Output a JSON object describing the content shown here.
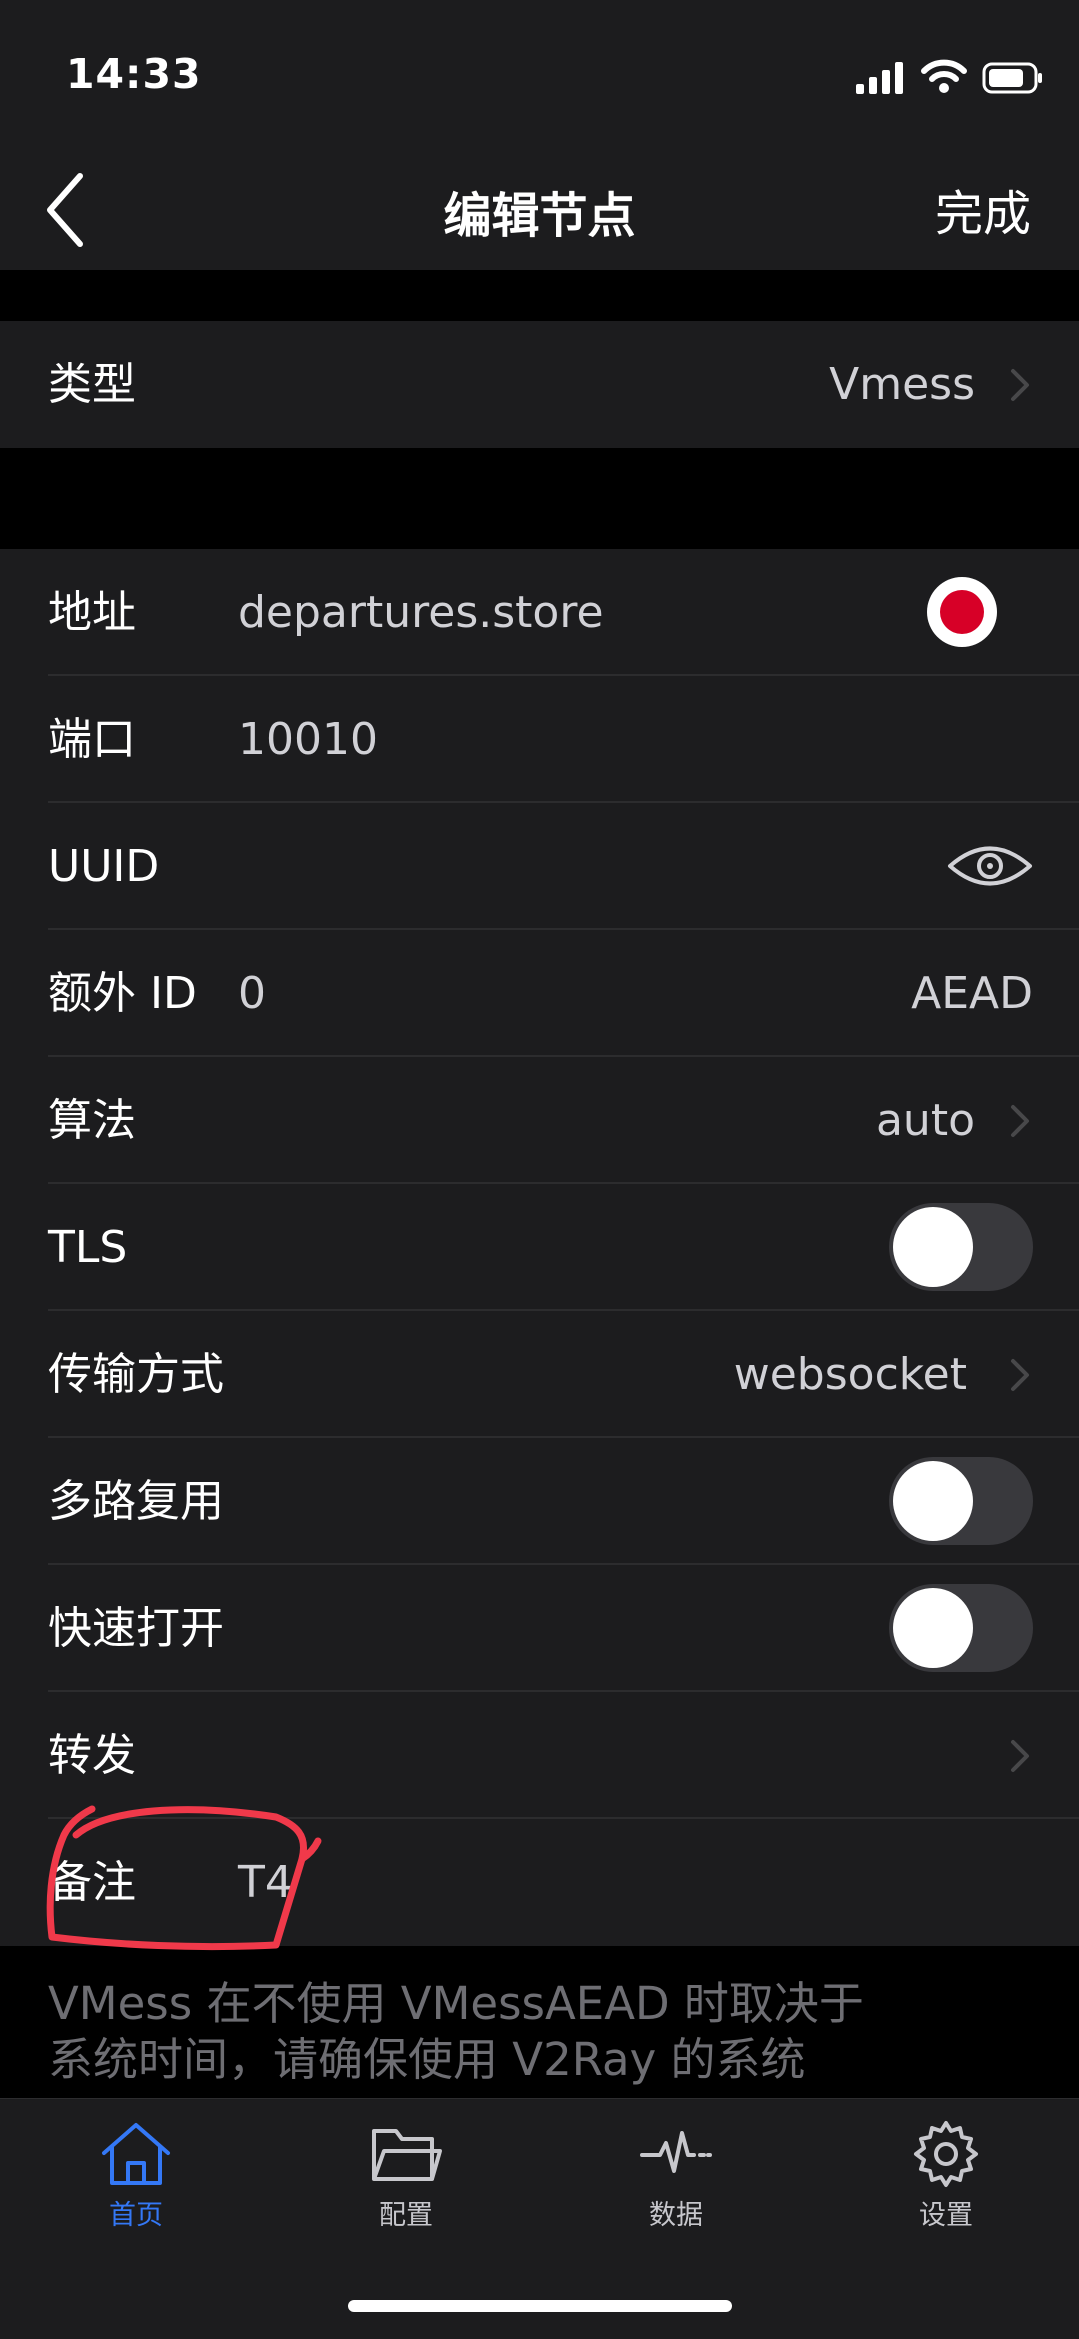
{
  "status_bar": {
    "time": "14:33"
  },
  "nav": {
    "title": "编辑节点",
    "done_label": "完成"
  },
  "type_section": {
    "label": "类型",
    "value": "Vmess"
  },
  "fields": {
    "address": {
      "label": "地址",
      "value": "departures.store"
    },
    "port": {
      "label": "端口",
      "value": "10010"
    },
    "uuid": {
      "label": "UUID"
    },
    "extra_id": {
      "label": "额外 ID",
      "value": "0",
      "aead": "AEAD"
    },
    "algorithm": {
      "label": "算法",
      "value": "auto"
    },
    "tls": {
      "label": "TLS",
      "on": false
    },
    "transport": {
      "label": "传输方式",
      "value": "websocket"
    },
    "multiplex": {
      "label": "多路复用",
      "on": false
    },
    "fast_open": {
      "label": "快速打开",
      "on": false
    },
    "forward": {
      "label": "转发"
    },
    "remark": {
      "label": "备注",
      "value": "T4"
    }
  },
  "footer_note": {
    "line1": "VMess 在不使用 VMessAEAD 时取决于",
    "line2": "系统时间，请确保使用 V2Ray 的系统"
  },
  "tabs": [
    {
      "label": "首页",
      "icon": "home-icon",
      "active": true
    },
    {
      "label": "配置",
      "icon": "folder-icon",
      "active": false
    },
    {
      "label": "数据",
      "icon": "pulse-icon",
      "active": false
    },
    {
      "label": "设置",
      "icon": "gear-icon",
      "active": false
    }
  ],
  "colors": {
    "background": "#000000",
    "cell": "#1c1c1e",
    "accent": "#3478f6",
    "record": "#d70027",
    "annotation": "#f0394a"
  }
}
